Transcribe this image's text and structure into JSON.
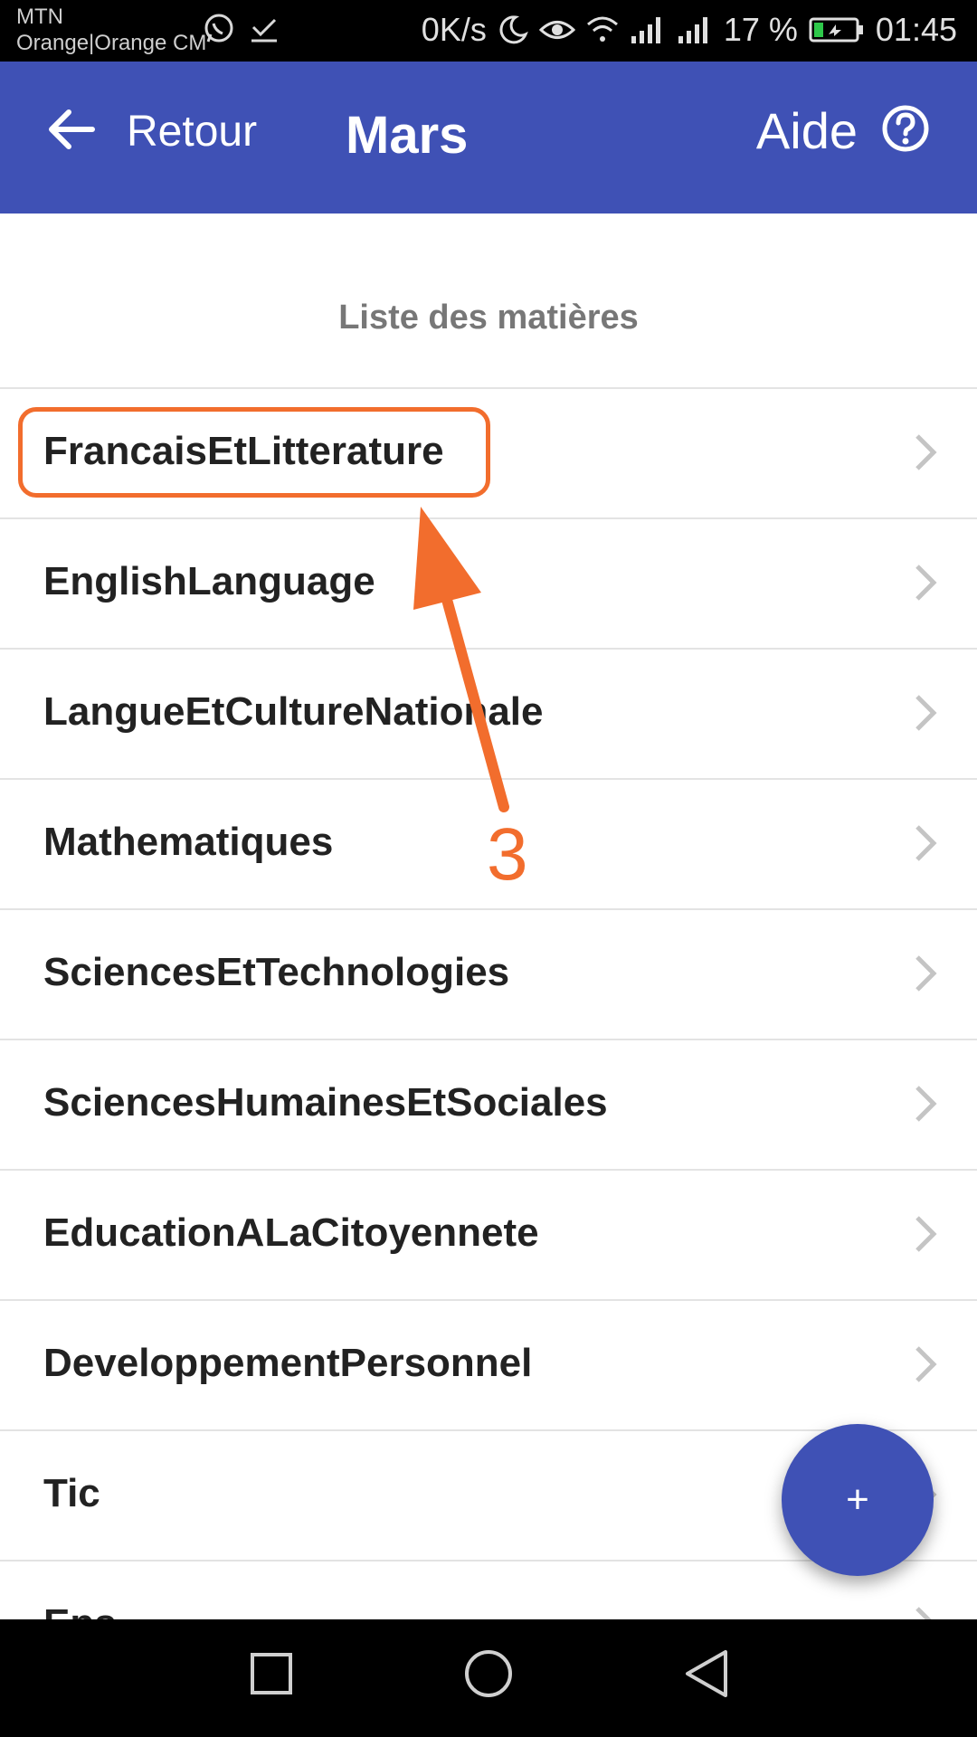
{
  "status_bar": {
    "carrier_line1": "MTN",
    "carrier_line2": "Orange|Orange CM",
    "net_speed": "0K/s",
    "battery_percent": "17 %",
    "time": "01:45"
  },
  "app_bar": {
    "back_label": "Retour",
    "title": "Mars",
    "help_label": "Aide"
  },
  "section_title": "Liste des matières",
  "subjects": [
    {
      "label": "FrancaisEtLitterature"
    },
    {
      "label": "EnglishLanguage"
    },
    {
      "label": "LangueEtCultureNationale"
    },
    {
      "label": "Mathematiques"
    },
    {
      "label": "SciencesEtTechnologies"
    },
    {
      "label": "SciencesHumainesEtSociales"
    },
    {
      "label": "EducationALaCitoyennete"
    },
    {
      "label": "DeveloppementPersonnel"
    },
    {
      "label": "Tic"
    },
    {
      "label": "Eps"
    }
  ],
  "annotation": {
    "step_number": "3",
    "color": "#f26d2d"
  },
  "fab": {
    "icon": "+"
  },
  "colors": {
    "primary": "#3f51b5",
    "annotation": "#f26d2d"
  },
  "icons": {
    "back": "arrow-left-icon",
    "help": "question-circle-icon",
    "chevron": "chevron-right-icon",
    "nav_recent": "square-icon",
    "nav_home": "circle-icon",
    "nav_back": "triangle-back-icon"
  }
}
